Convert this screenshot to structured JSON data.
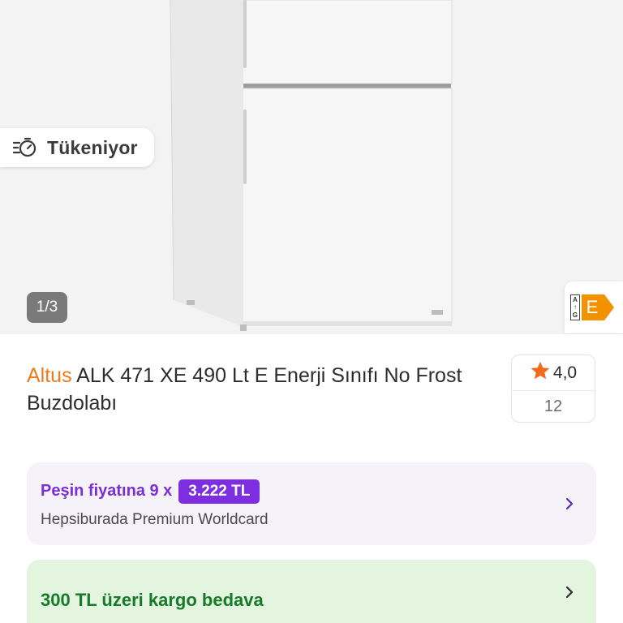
{
  "gallery": {
    "stock_label": "Tükeniyor",
    "counter": "1/3",
    "energy_scale": [
      "A",
      "↑",
      "G"
    ],
    "energy_class": "E",
    "energy_class_color": "#f39200"
  },
  "product": {
    "brand": "Altus",
    "name": " ALK 471 XE 490 Lt E Enerji Sınıfı No Frost Buzdolabı",
    "brand_color": "#f07a1a"
  },
  "rating": {
    "score": "4,0",
    "review_count": "12",
    "star_color": "#f26a1b"
  },
  "installment": {
    "text": "Peşin fiyatına 9 x",
    "price": "3.222 TL",
    "card_name": "Hepsiburada Premium Worldcard",
    "accent_color": "#7c2ee0"
  },
  "shipping": {
    "text": "300 TL üzeri kargo bedava",
    "accent_color": "#167a2a"
  },
  "icons": {
    "stock": "fast-timer-icon",
    "rating": "star-icon",
    "chevron": "chevron-right-icon"
  }
}
